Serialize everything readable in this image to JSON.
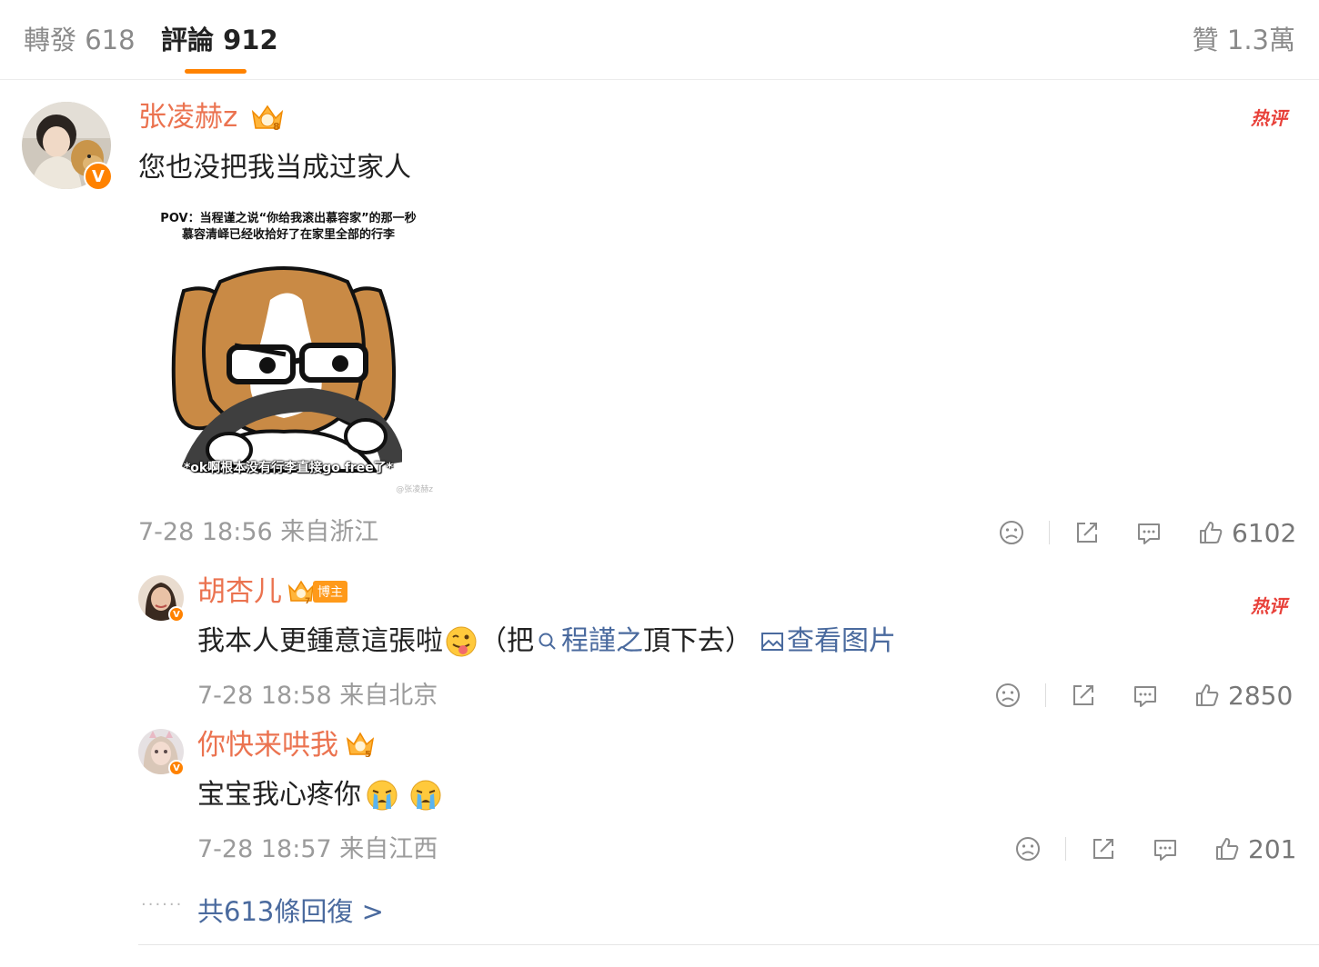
{
  "tabs": {
    "repost": "轉發 618",
    "comments": "評論 912",
    "likes": "贊 1.3萬"
  },
  "main_comment": {
    "username": "张凌赫z",
    "crown_level": "8",
    "text": "您也没把我当成过家人",
    "hot_label": "热评",
    "image": {
      "caption_line1": "POV：当程谨之说“你给我滚出慕容家”的那一秒",
      "caption_line2": "慕容清峄已经收拾好了在家里全部的行李",
      "subtitle": "*ok啊根本没有行李直接go free了*",
      "watermark": "@张凌赫z"
    },
    "time": "7-28 18:56 来自浙江",
    "like_count": "6102"
  },
  "replies": [
    {
      "username": "胡杏儿",
      "badge": "博主",
      "crown_level": "7",
      "text_prefix": "我本人更鍾意這張啦",
      "text_open": "（把",
      "link_text": "程謹之",
      "text_after": "頂下去）",
      "view_image": "查看图片",
      "hot_label": "热评",
      "time": "7-28 18:58 来自北京",
      "like_count": "2850"
    },
    {
      "username": "你快来哄我",
      "crown_level": "5",
      "text": "宝宝我心疼你",
      "time": "7-28 18:57 来自江西",
      "like_count": "201"
    }
  ],
  "more_replies": "共613條回復 >",
  "icons": {
    "verified": "V",
    "crown_color": "#ff9a1a",
    "accent": "#ff8200"
  }
}
